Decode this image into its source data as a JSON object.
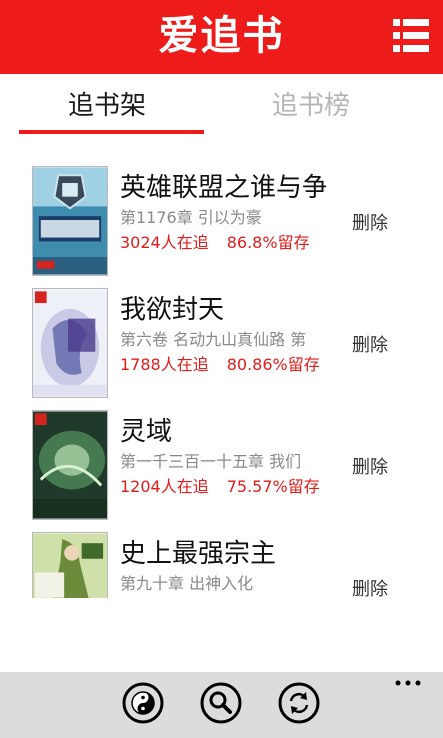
{
  "header": {
    "title": "爱追书"
  },
  "tabs": {
    "shelf": "追书架",
    "rank": "追书榜"
  },
  "books": [
    {
      "title": "英雄联盟之谁与争锋",
      "chapter": "第1176章 引以为豪",
      "followers": "3024人在追",
      "retention": "86.8%留存",
      "action": "删除"
    },
    {
      "title": "我欲封天",
      "chapter": "第六卷 名动九山真仙路 第",
      "followers": "1788人在追",
      "retention": "80.86%留存",
      "action": "删除"
    },
    {
      "title": "灵域",
      "chapter": "第一千三百一十五章 我们",
      "followers": "1204人在追",
      "retention": "75.57%留存",
      "action": "删除"
    },
    {
      "title": "史上最强宗主",
      "chapter": "第九十章 出神入化",
      "followers": "",
      "retention": "",
      "action": "删除"
    }
  ],
  "bottom_bar": {
    "icons": [
      "yin-yang-icon",
      "search-icon",
      "refresh-icon",
      "more-icon"
    ]
  },
  "colors": {
    "accent": "#ee1b1b",
    "bar": "#dcdcdc"
  }
}
